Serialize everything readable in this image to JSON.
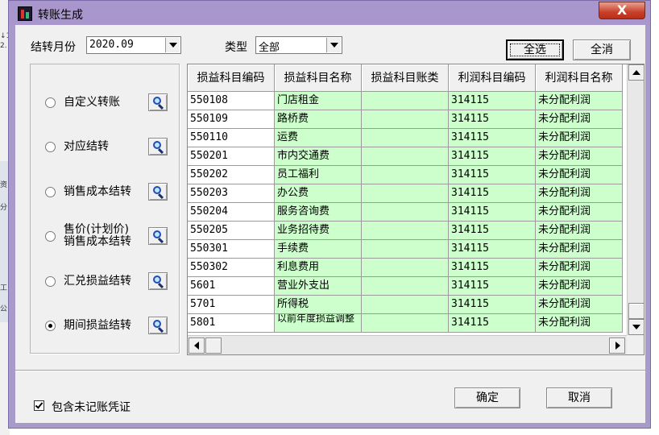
{
  "window": {
    "title": "转账生成",
    "close_glyph": "X"
  },
  "background": {
    "fragments": [
      "↓1",
      "2.",
      "资",
      "分",
      "工",
      "公"
    ]
  },
  "filters": {
    "month_label": "结转月份",
    "month_value": "2020.09",
    "type_label": "类型",
    "type_value": "全部"
  },
  "buttons": {
    "select_all": "全选",
    "clear_all": "全消",
    "confirm": "确定",
    "cancel": "取消"
  },
  "options": [
    {
      "label": "自定义转账",
      "selected": false
    },
    {
      "label": "对应结转",
      "selected": false
    },
    {
      "label": "销售成本结转",
      "selected": false
    },
    {
      "label": "售价(计划价)",
      "label2": "销售成本结转",
      "selected": false
    },
    {
      "label": "汇兑损益结转",
      "selected": false
    },
    {
      "label": "期间损益结转",
      "selected": true
    }
  ],
  "grid": {
    "columns": [
      "损益科目编码",
      "损益科目名称",
      "损益科目账类",
      "利润科目编码",
      "利润科目名称"
    ],
    "rows": [
      [
        "550108",
        "门店租金",
        "",
        "314115",
        "未分配利润"
      ],
      [
        "550109",
        "路桥费",
        "",
        "314115",
        "未分配利润"
      ],
      [
        "550110",
        "运费",
        "",
        "314115",
        "未分配利润"
      ],
      [
        "550201",
        "市内交通费",
        "",
        "314115",
        "未分配利润"
      ],
      [
        "550202",
        "员工福利",
        "",
        "314115",
        "未分配利润"
      ],
      [
        "550203",
        "办公费",
        "",
        "314115",
        "未分配利润"
      ],
      [
        "550204",
        "服务咨询费",
        "",
        "314115",
        "未分配利润"
      ],
      [
        "550205",
        "业务招待费",
        "",
        "314115",
        "未分配利润"
      ],
      [
        "550301",
        "手续费",
        "",
        "314115",
        "未分配利润"
      ],
      [
        "550302",
        "利息费用",
        "",
        "314115",
        "未分配利润"
      ],
      [
        "5601",
        "营业外支出",
        "",
        "314115",
        "未分配利润"
      ],
      [
        "5701",
        "所得税",
        "",
        "314115",
        "未分配利润"
      ],
      [
        "5801",
        "以前年度损益调整",
        "",
        "314115",
        "未分配利润"
      ]
    ]
  },
  "include_unposted": {
    "label": "包含未记账凭证",
    "checked": true
  },
  "colors": {
    "row_green": "#ccffcc",
    "title_bar": "#a896cc"
  }
}
